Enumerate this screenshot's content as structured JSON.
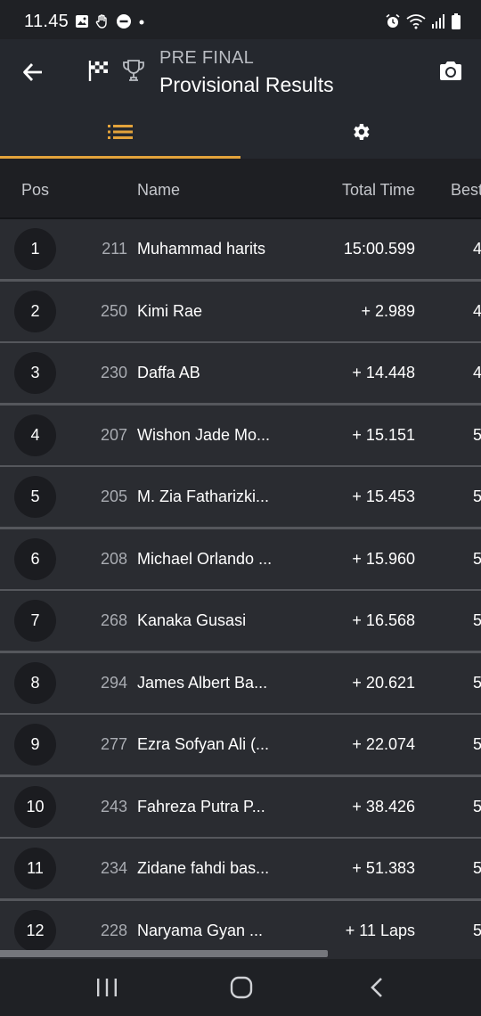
{
  "status_bar": {
    "time": "11.45",
    "left_icons": [
      "gallery-icon",
      "hand-icon",
      "minus-circle-icon",
      "dot-icon"
    ],
    "right_icons": [
      "alarm-icon",
      "wifi-icon",
      "signal-icon",
      "battery-icon"
    ]
  },
  "app_bar": {
    "subtitle": "PRE FINAL",
    "title": "Provisional Results",
    "back_icon": "arrow-left-icon",
    "flag_icon": "checkered-flag-icon",
    "trophy_icon": "trophy-icon",
    "camera_icon": "camera-icon"
  },
  "tabs": [
    {
      "icon": "list-icon",
      "active": true
    },
    {
      "icon": "gear-icon",
      "active": false
    }
  ],
  "colors": {
    "accent": "#e3a33b",
    "background": "#1c1d21",
    "row_background": "#2a2c31",
    "app_bar": "#25282e"
  },
  "table": {
    "columns": {
      "pos": "Pos",
      "name": "Name",
      "total_time": "Total Time",
      "best": "Best"
    },
    "rows": [
      {
        "pos": "1",
        "no": "211",
        "name": "Muhammad harits",
        "time": "15:00.599",
        "best": "4"
      },
      {
        "pos": "2",
        "no": "250",
        "name": "Kimi Rae",
        "time": "+ 2.989",
        "best": "4"
      },
      {
        "pos": "3",
        "no": "230",
        "name": "Daffa AB",
        "time": "+ 14.448",
        "best": "4"
      },
      {
        "pos": "4",
        "no": "207",
        "name": "Wishon Jade Mo...",
        "time": "+ 15.151",
        "best": "5"
      },
      {
        "pos": "5",
        "no": "205",
        "name": "M. Zia Fatharizki...",
        "time": "+ 15.453",
        "best": "5"
      },
      {
        "pos": "6",
        "no": "208",
        "name": "Michael Orlando ...",
        "time": "+ 15.960",
        "best": "5"
      },
      {
        "pos": "7",
        "no": "268",
        "name": "Kanaka Gusasi",
        "time": "+ 16.568",
        "best": "5"
      },
      {
        "pos": "8",
        "no": "294",
        "name": "James Albert Ba...",
        "time": "+ 20.621",
        "best": "5"
      },
      {
        "pos": "9",
        "no": "277",
        "name": "Ezra Sofyan Ali (...",
        "time": "+ 22.074",
        "best": "5"
      },
      {
        "pos": "10",
        "no": "243",
        "name": "Fahreza Putra P...",
        "time": "+ 38.426",
        "best": "5"
      },
      {
        "pos": "11",
        "no": "234",
        "name": "Zidane fahdi bas...",
        "time": "+ 51.383",
        "best": "5"
      },
      {
        "pos": "12",
        "no": "228",
        "name": "Naryama Gyan ...",
        "time": "+ 11 Laps",
        "best": "5"
      }
    ]
  },
  "nav_bar": {
    "recents_icon": "recents-icon",
    "home_icon": "home-icon",
    "back_icon": "nav-back-icon"
  }
}
